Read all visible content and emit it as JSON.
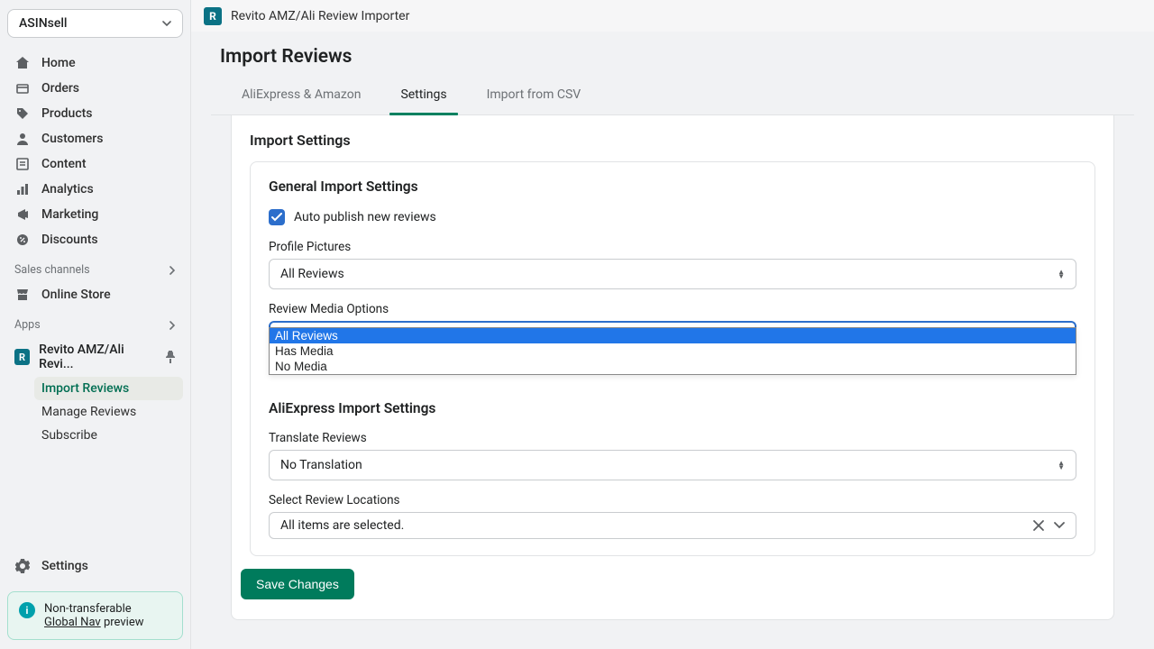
{
  "store_name": "ASINsell",
  "nav": {
    "home": "Home",
    "orders": "Orders",
    "products": "Products",
    "customers": "Customers",
    "content": "Content",
    "analytics": "Analytics",
    "marketing": "Marketing",
    "discounts": "Discounts"
  },
  "sections": {
    "sales_channels": "Sales channels",
    "online_store": "Online Store",
    "apps": "Apps"
  },
  "app": {
    "name_short": "Revito AMZ/Ali Revi...",
    "name_full": "Revito AMZ/Ali Review Importer",
    "sub": {
      "import": "Import Reviews",
      "manage": "Manage Reviews",
      "subscribe": "Subscribe"
    }
  },
  "settings_label": "Settings",
  "notice": {
    "line1": "Non-transferable",
    "link": "Global Nav",
    "after": " preview"
  },
  "page": {
    "title": "Import Reviews",
    "tabs": {
      "ali_amazon": "AliExpress & Amazon",
      "settings": "Settings",
      "csv": "Import from CSV"
    },
    "section_title": "Import Settings",
    "general": {
      "heading": "General Import Settings",
      "auto_publish": "Auto publish new reviews",
      "profile_pictures_label": "Profile Pictures",
      "profile_pictures_value": "All Reviews",
      "media_label": "Review Media Options",
      "media_value": "All Reviews",
      "media_options": {
        "o1": "All Reviews",
        "o2": "Has Media",
        "o3": "No Media"
      }
    },
    "aliexpress": {
      "heading": "AliExpress Import Settings",
      "translate_label": "Translate Reviews",
      "translate_value": "No Translation",
      "locations_label": "Select Review Locations",
      "locations_value": "All items are selected."
    },
    "save": "Save Changes"
  }
}
